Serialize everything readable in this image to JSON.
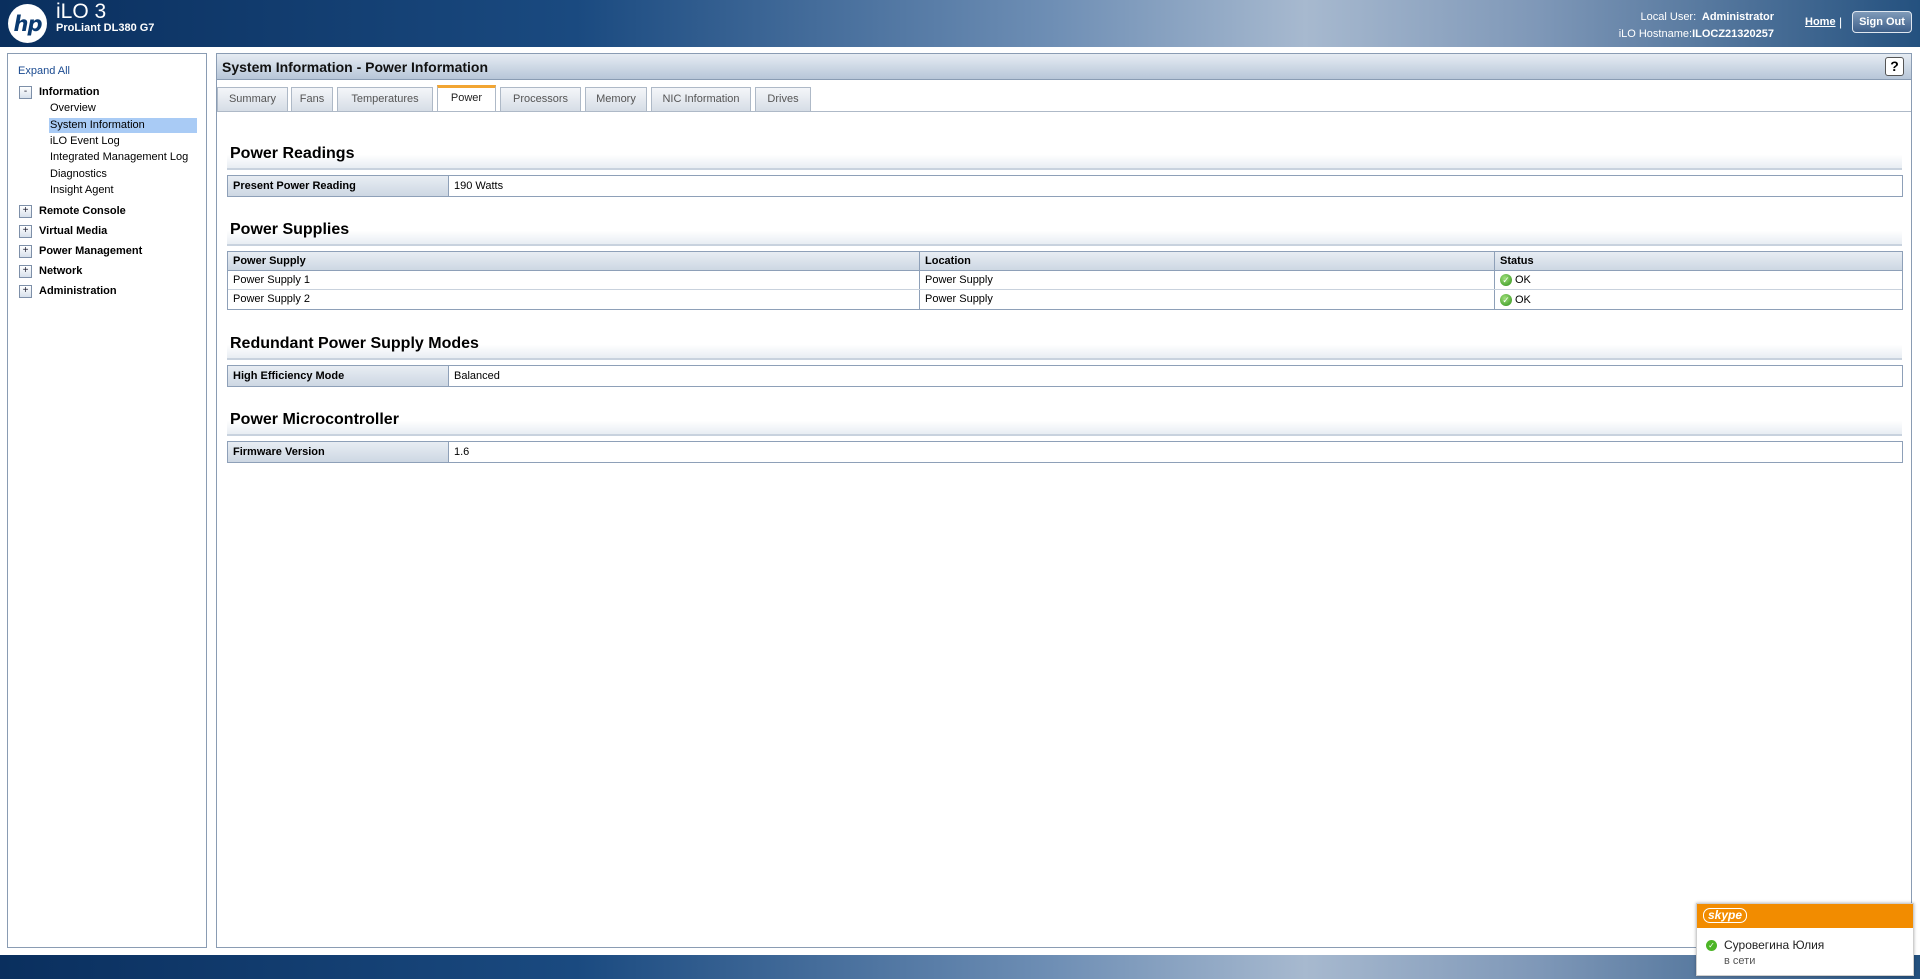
{
  "header": {
    "logo_text": "hp",
    "product": "iLO 3",
    "model": "ProLiant DL380 G7",
    "local_user_label": "Local User:",
    "local_user": "Administrator",
    "hostname_label": "iLO Hostname:",
    "hostname": "ILOCZ21320257",
    "home_link": "Home",
    "separator": "|",
    "sign_out": "Sign Out"
  },
  "sidebar": {
    "expand_all": "Expand All",
    "information": {
      "toggle": "-",
      "label": "Information",
      "items": [
        {
          "label": "Overview"
        },
        {
          "label": "System Information"
        },
        {
          "label": "iLO Event Log"
        },
        {
          "label": "Integrated Management Log"
        },
        {
          "label": "Diagnostics"
        },
        {
          "label": "Insight Agent"
        }
      ]
    },
    "groups": [
      {
        "toggle": "+",
        "label": "Remote Console"
      },
      {
        "toggle": "+",
        "label": "Virtual Media"
      },
      {
        "toggle": "+",
        "label": "Power Management"
      },
      {
        "toggle": "+",
        "label": "Network"
      },
      {
        "toggle": "+",
        "label": "Administration"
      }
    ]
  },
  "main": {
    "title": "System Information - Power Information",
    "help": "?",
    "tabs": [
      {
        "label": "Summary"
      },
      {
        "label": "Fans"
      },
      {
        "label": "Temperatures"
      },
      {
        "label": "Power"
      },
      {
        "label": "Processors"
      },
      {
        "label": "Memory"
      },
      {
        "label": "NIC Information"
      },
      {
        "label": "Drives"
      }
    ],
    "active_tab": "Power",
    "power_readings": {
      "title": "Power Readings",
      "key": "Present Power Reading",
      "value": "190 Watts"
    },
    "power_supplies": {
      "title": "Power Supplies",
      "columns": [
        "Power Supply",
        "Location",
        "Status"
      ],
      "rows": [
        {
          "name": "Power Supply 1",
          "location": "Power Supply",
          "status": "OK"
        },
        {
          "name": "Power Supply 2",
          "location": "Power Supply",
          "status": "OK"
        }
      ]
    },
    "redundant": {
      "title": "Redundant Power Supply Modes",
      "key": "High Efficiency Mode",
      "value": "Balanced"
    },
    "microcontroller": {
      "title": "Power Microcontroller",
      "key": "Firmware Version",
      "value": "1.6"
    }
  },
  "skype": {
    "brand": "skype",
    "contact": "Суровегина Юлия",
    "status": "в сети"
  },
  "colors": {
    "accent_tab": "#f2a532",
    "selected_nav": "#a9cbf5",
    "status_ok": "#2f8f1a",
    "skype_orange": "#f28c00"
  }
}
